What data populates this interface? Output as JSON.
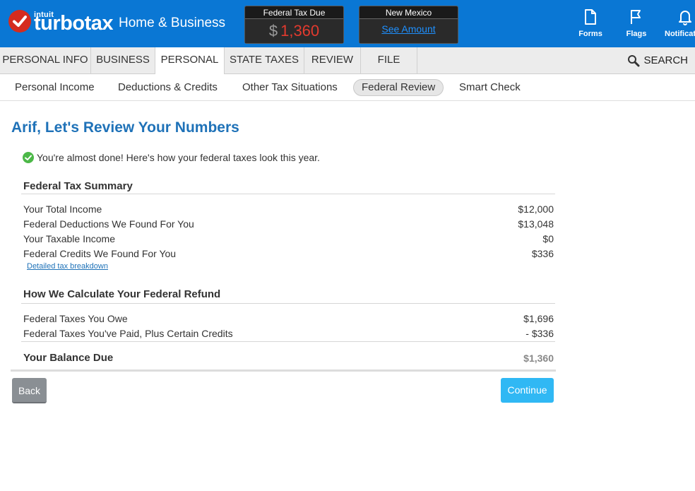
{
  "header": {
    "brand_intuit": "intuit",
    "brand_name": "turbotax",
    "brand_edition": "Home & Business",
    "federal_box": {
      "title": "Federal Tax Due",
      "currency": "$",
      "amount": "1,360"
    },
    "state_box": {
      "title": "New Mexico",
      "link": "See Amount"
    },
    "icons": [
      {
        "label": "Forms",
        "icon": "document-icon"
      },
      {
        "label": "Flags",
        "icon": "flag-icon"
      },
      {
        "label": "Notifications",
        "icon": "bell-icon"
      }
    ],
    "colors": {
      "bar": "#0a77d4",
      "logo_red": "#d52b1e",
      "due_red": "#e23a2e"
    }
  },
  "main_nav": {
    "tabs": [
      "PERSONAL INFO",
      "BUSINESS",
      "PERSONAL",
      "STATE TAXES",
      "REVIEW",
      "FILE"
    ],
    "active": "PERSONAL",
    "search_label": "SEARCH"
  },
  "sub_nav": {
    "tabs": [
      "Personal Income",
      "Deductions & Credits",
      "Other Tax Situations",
      "Federal Review",
      "Smart Check"
    ],
    "active": "Federal Review"
  },
  "page": {
    "title": "Arif, Let's Review Your Numbers",
    "notice": "You're almost done! Here's how your federal taxes look this year.",
    "summary": {
      "title": "Federal Tax Summary",
      "rows": [
        {
          "label": "Your Total Income",
          "value": "$12,000"
        },
        {
          "label": "Federal Deductions We Found For You",
          "value": "$13,048"
        },
        {
          "label": "Your Taxable Income",
          "value": "$0"
        },
        {
          "label": "Federal Credits We Found For You",
          "value": "$336"
        }
      ],
      "link": "Detailed tax breakdown"
    },
    "calculation": {
      "title": "How We Calculate Your Federal Refund",
      "rows": [
        {
          "label": "Federal Taxes You Owe",
          "value": "$1,696"
        },
        {
          "label": "Federal Taxes You've Paid, Plus Certain Credits",
          "value": "- $336"
        }
      ]
    },
    "balance": {
      "label": "Your Balance Due",
      "value": "$1,360"
    },
    "buttons": {
      "back": "Back",
      "continue": "Continue"
    }
  }
}
